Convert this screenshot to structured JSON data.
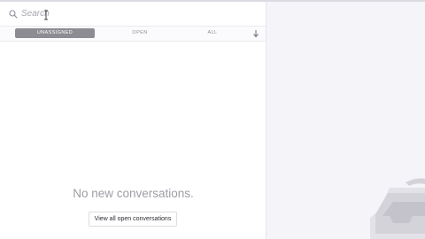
{
  "search": {
    "placeholder": "Search",
    "icon": "search-icon"
  },
  "tabs": [
    {
      "label": "UNASSIGNED",
      "active": true
    },
    {
      "label": "OPEN",
      "active": false
    },
    {
      "label": "ALL",
      "active": false
    }
  ],
  "sort_icon": "arrow-down-icon",
  "empty_state": {
    "message": "No new conversations.",
    "button_label": "View all open conversations"
  },
  "illustration_icon": "inbox-tray-icon",
  "colors": {
    "active_tab_bg": "#8d8c93",
    "right_panel_bg": "#f5f4f8",
    "muted_text": "#9e9da6"
  }
}
